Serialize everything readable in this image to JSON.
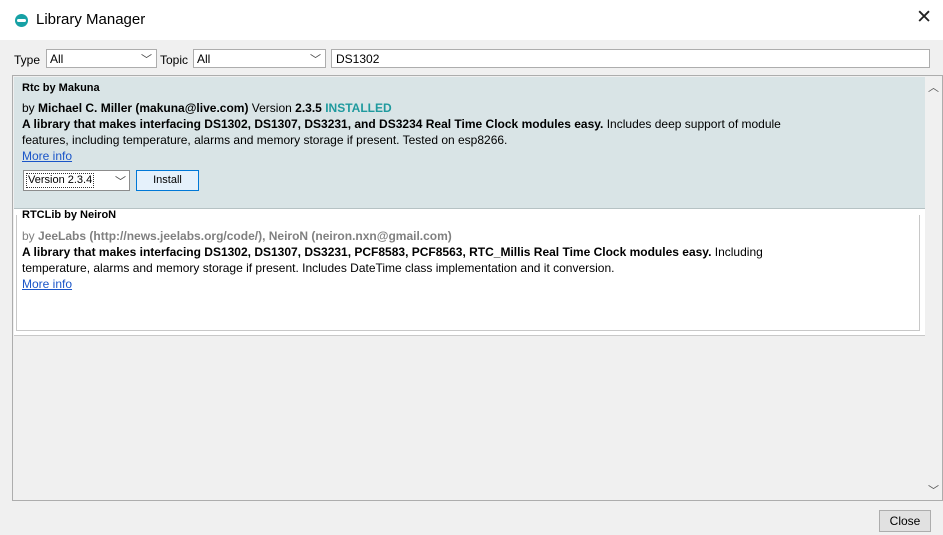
{
  "window": {
    "title": "Library Manager",
    "close_glyph": "✕",
    "app_icon": "arduino-icon"
  },
  "filters": {
    "type_label": "Type",
    "type_value": "All",
    "topic_label": "Topic",
    "topic_value": "All",
    "search_value": "DS1302",
    "dropdown_glyph": "﹀"
  },
  "libraries": [
    {
      "title": "Rtc by Makuna",
      "by_prefix": "by ",
      "author": "Michael C. Miller (makuna@live.com)",
      "version_label": " Version ",
      "version": "2.3.5",
      "installed": "INSTALLED",
      "sentence_bold": "A library that makes interfacing DS1302, DS1307, DS3231, and DS3234 Real Time Clock modules easy.",
      "sentence_rest": " Includes deep support of module",
      "desc_line2": "features, including temperature, alarms and memory storage if present. Tested on esp8266.",
      "more_info": "More info",
      "selected_version": "Version 2.3.4",
      "install_label": "Install"
    },
    {
      "title": "RTCLib by NeiroN",
      "by_prefix": "by ",
      "author": "JeeLabs (http://news.jeelabs.org/code/), NeiroN (neiron.nxn@gmail.com)",
      "sentence_bold": "A library that makes interfacing DS1302, DS1307, DS3231, PCF8583, PCF8563, RTC_Millis Real Time Clock modules easy.",
      "sentence_rest": " Including",
      "desc_line2": "temperature, alarms and memory storage if present. Includes DateTime class implementation and it conversion.",
      "more_info": "More info"
    }
  ],
  "footer": {
    "close_label": "Close"
  },
  "colors": {
    "selected_bg": "#d9e4e6",
    "installed": "#1f9a9e",
    "link": "#1a55c8",
    "button_focus": "#0078d7"
  }
}
